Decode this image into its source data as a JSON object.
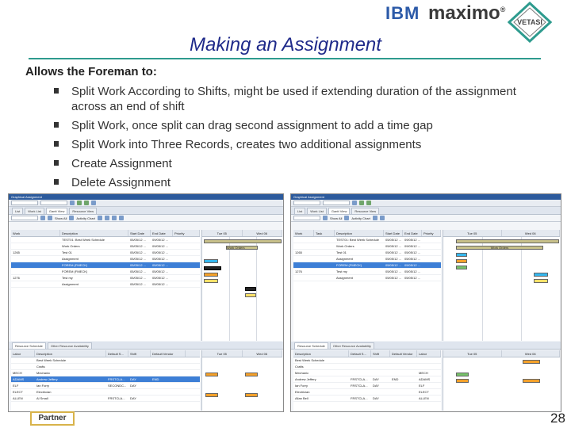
{
  "brand": {
    "ibm": "IBM",
    "product": "maximo",
    "partner_logo": "VETASI"
  },
  "slide": {
    "title": "Making an Assignment",
    "lead": "Allows the Foreman to:",
    "bullets": [
      "Split Work According to Shifts, might be used if extending duration of the assignment across an end of shift",
      "Split Work, once split can drag second assignment to add a time gap",
      "Split Work into Three Records, creates two additional assignments",
      "Create Assignment",
      "Delete Assignment"
    ],
    "partner_badge": "Partner",
    "page_number": "28"
  },
  "left_app": {
    "title": "Graphical Assignment",
    "tabs": [
      "List",
      "Work List",
      "Gantt View",
      "Resource View"
    ],
    "buttons": {
      "show_all": "Show All",
      "activity_chart": "Activity Chart"
    },
    "columns": [
      "Work",
      "Description",
      "Start Date",
      "End Date",
      "Priority"
    ],
    "days": [
      "Tue 05",
      "Wed 06"
    ],
    "rows": [
      {
        "work": "",
        "description": "TEST01: Best Week Schedule",
        "start": "05/05/12 ...",
        "end": "09/05/12 ..."
      },
      {
        "work": "",
        "description": "Work Orders",
        "start": "05/05/12 ...",
        "end": "09/05/12 ..."
      },
      {
        "work": "1265",
        "description": "Test 01",
        "start": "05/05/12 ...",
        "end": "05/05/12 ..."
      },
      {
        "work": "",
        "description": "Assignment",
        "start": "05/05/12 ...",
        "end": "05/05/12 ..."
      },
      {
        "work": "",
        "description": "FOREM (FMECK)",
        "start": "05/05/12 ...",
        "end": "05/05/12 ..."
      },
      {
        "work": "",
        "description": "FOREM (FMECK)",
        "start": "05/05/12 ...",
        "end": "05/05/12 ..."
      },
      {
        "work": "1276",
        "description": "Test my",
        "start": "05/05/12 ...",
        "end": "05/05/12 ..."
      },
      {
        "work": "",
        "description": "Assignment",
        "start": "05/05/12 ...",
        "end": "05/05/12 ..."
      }
    ],
    "resource_tabs": [
      "Resource Schedule",
      "Other Resource Availability"
    ],
    "resource_columns": [
      "Labor",
      "Description",
      "Default S...",
      "Shift",
      "Default Vendor"
    ],
    "resources": [
      {
        "labor": "",
        "description": "Best Week Schedule",
        "default": "",
        "shift": "",
        "vendor": ""
      },
      {
        "labor": "",
        "description": "Crafts",
        "default": "",
        "shift": "",
        "vendor": ""
      },
      {
        "labor": "MECH",
        "description": "Mechanic",
        "default": "",
        "shift": "",
        "vendor": ""
      },
      {
        "labor": "ADAMS",
        "description": "Andrew Jeffery",
        "default": "FRSTCLA...",
        "shift": "DAY",
        "vendor": "END"
      },
      {
        "labor": "ELF",
        "description": "Ian Forry",
        "default": "SECONDC...",
        "shift": "DAY",
        "vendor": ""
      },
      {
        "labor": "ELECT",
        "description": "Electrician",
        "default": "",
        "shift": "",
        "vendor": ""
      },
      {
        "labor": "ALLEN",
        "description": "Al Small",
        "default": "FRSTCLA...",
        "shift": "DAY",
        "vendor": ""
      },
      {
        "labor": "POTTER",
        "description": "John Potter",
        "default": "FRSTCLA...",
        "shift": "DAY",
        "vendor": "CMC"
      }
    ],
    "gantt_labels": {
      "summary": "Work Orders"
    }
  },
  "right_app": {
    "title": "Graphical Assignment",
    "tabs": [
      "List",
      "Work List",
      "Gantt View",
      "Resource View"
    ],
    "buttons": {
      "show_all": "Show All",
      "activity_chart": "Activity Chart"
    },
    "columns": [
      "Work",
      "Task",
      "Description",
      "Start Date",
      "End Date",
      "Priority"
    ],
    "days": [
      "Tue 05",
      "Wed 06"
    ],
    "rows": [
      {
        "work": "",
        "task": "",
        "description": "TEST01: Best Week Schedule",
        "start": "05/05/12 ...",
        "end": "09/05/12 ..."
      },
      {
        "work": "",
        "task": "",
        "description": "Work Orders",
        "start": "05/05/12 ...",
        "end": "09/05/12 ..."
      },
      {
        "work": "1265",
        "task": "",
        "description": "Test 01",
        "start": "05/05/12 ...",
        "end": "05/05/12 ..."
      },
      {
        "work": "",
        "task": "",
        "description": "Assignment",
        "start": "05/05/12 ...",
        "end": "05/05/12 ..."
      },
      {
        "work": "",
        "task": "",
        "description": "FOREM (FMECK)",
        "start": "05/05/12 ...",
        "end": "05/05/12 ..."
      },
      {
        "work": "1276",
        "task": "",
        "description": "Test my",
        "start": "05/05/12 ...",
        "end": "05/05/12 ..."
      },
      {
        "work": "",
        "task": "",
        "description": "Assignment",
        "start": "05/05/12 ...",
        "end": "05/05/12 ..."
      }
    ],
    "resource_tabs": [
      "Resource Schedule",
      "Other Resource Availability"
    ],
    "resource_columns": [
      "Description",
      "Default S...",
      "Shift",
      "Default Vendor",
      "Labor"
    ],
    "resources": [
      {
        "description": "Best Week Schedule",
        "default": "",
        "shift": "",
        "vendor": "",
        "labor": ""
      },
      {
        "description": "Crafts",
        "default": "",
        "shift": "",
        "vendor": "",
        "labor": ""
      },
      {
        "description": "Mechanic",
        "default": "",
        "shift": "",
        "vendor": "",
        "labor": "MECH"
      },
      {
        "description": "Andrew Jeffery",
        "default": "FRSTCLA...",
        "shift": "DAY",
        "vendor": "END",
        "labor": "ADAMS"
      },
      {
        "description": "Ian Forry",
        "default": "FRSTCLA...",
        "shift": "DAY",
        "vendor": "",
        "labor": "ELF"
      },
      {
        "description": "Electrician",
        "default": "",
        "shift": "",
        "vendor": "",
        "labor": "ELECT"
      },
      {
        "description": "Allan Bell",
        "default": "FRSTCLA...",
        "shift": "DAY",
        "vendor": "",
        "labor": "ALLEN"
      },
      {
        "description": "Evan Potter",
        "default": "FRSTCLA...",
        "shift": "DAY",
        "vendor": "CMC",
        "labor": "POTTER"
      }
    ],
    "gantt_labels": {
      "summary": "Work Orders"
    }
  },
  "colors": {
    "title": "#1f2a8a",
    "rule": "#2e9b8e",
    "selection": "#3d7fd6"
  }
}
